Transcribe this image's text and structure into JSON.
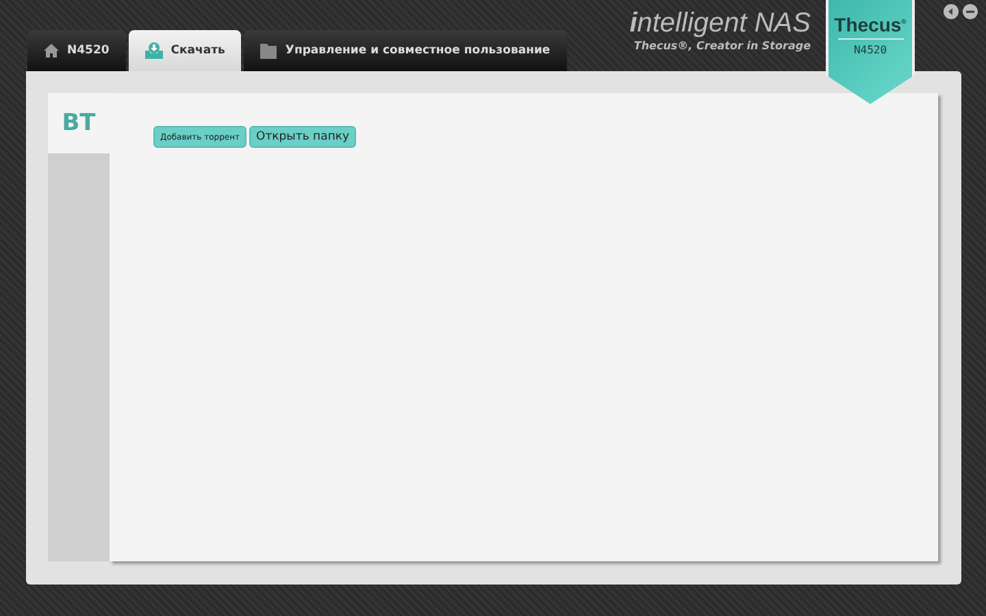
{
  "tabs": [
    {
      "label": "N4520",
      "kind": "home",
      "selected": false
    },
    {
      "label": "Скачать",
      "kind": "download",
      "selected": true
    },
    {
      "label": "Управление и совместное пользование",
      "kind": "folder",
      "selected": false
    }
  ],
  "brand": {
    "title": "**i**ntelligent NAS",
    "tagline": "Thecus®, Creator in Storage",
    "badge_logo": "Thecus",
    "badge_mark": "®",
    "badge_model": "N4520"
  },
  "side_tabs": [
    {
      "label": "BT",
      "selected": true
    }
  ],
  "buttons": [
    {
      "label": "Добавить торрент",
      "kind": "small"
    },
    {
      "label": "Открыть папку",
      "kind": "normal"
    }
  ]
}
